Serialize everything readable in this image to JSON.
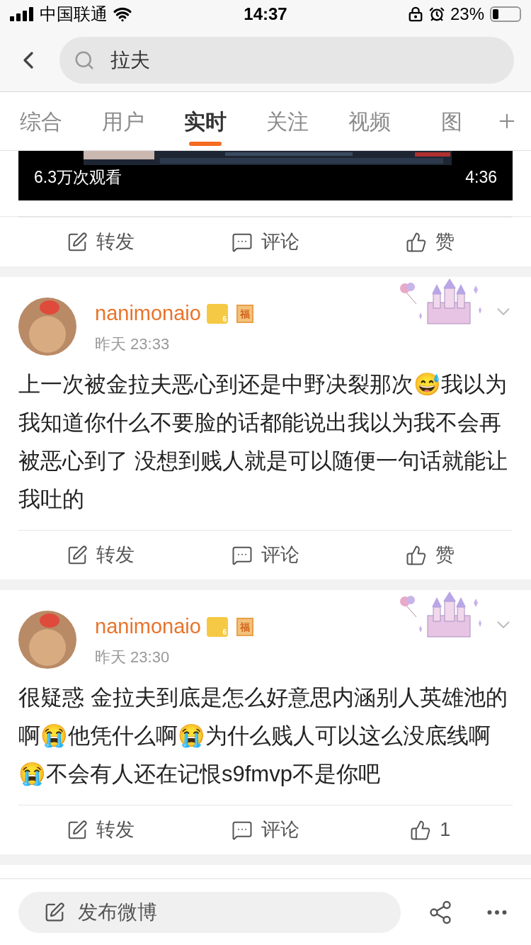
{
  "status_bar": {
    "carrier": "中国联通",
    "time": "14:37",
    "battery": "23%"
  },
  "search": {
    "value": "拉夫"
  },
  "tabs": [
    {
      "label": "综合",
      "selected": false
    },
    {
      "label": "用户",
      "selected": false
    },
    {
      "label": "实时",
      "selected": true
    },
    {
      "label": "关注",
      "selected": false
    },
    {
      "label": "视频",
      "selected": false
    },
    {
      "label": "图",
      "selected": false
    }
  ],
  "video_card": {
    "views": "6.3万次观看",
    "duration": "4:36",
    "actions": [
      {
        "kind": "repost",
        "label": "转发"
      },
      {
        "kind": "comment",
        "label": "评论"
      },
      {
        "kind": "like",
        "label": "赞"
      }
    ]
  },
  "posts": [
    {
      "user": "nanimonaio",
      "vip_level": "6",
      "badge": "福",
      "time": "昨天 23:33",
      "text": "上一次被金拉夫恶心到还是中野决裂那次😅我以为我知道你什么不要脸的话都能说出我以为我不会再被恶心到了 没想到贱人就是可以随便一句话就能让我吐的",
      "actions": [
        {
          "kind": "repost",
          "label": "转发"
        },
        {
          "kind": "comment",
          "label": "评论"
        },
        {
          "kind": "like",
          "label": "赞"
        }
      ]
    },
    {
      "user": "nanimonaio",
      "vip_level": "6",
      "badge": "福",
      "time": "昨天 23:30",
      "text": "很疑惑 金拉夫到底是怎么好意思内涵别人英雄池的啊😭他凭什么啊😭为什么贱人可以这么没底线啊😭不会有人还在记恨s9fmvp不是你吧",
      "actions": [
        {
          "kind": "repost",
          "label": "转发"
        },
        {
          "kind": "comment",
          "label": "评论"
        },
        {
          "kind": "like",
          "label": "1"
        }
      ]
    }
  ],
  "bottom_bar": {
    "compose": "发布微博"
  }
}
